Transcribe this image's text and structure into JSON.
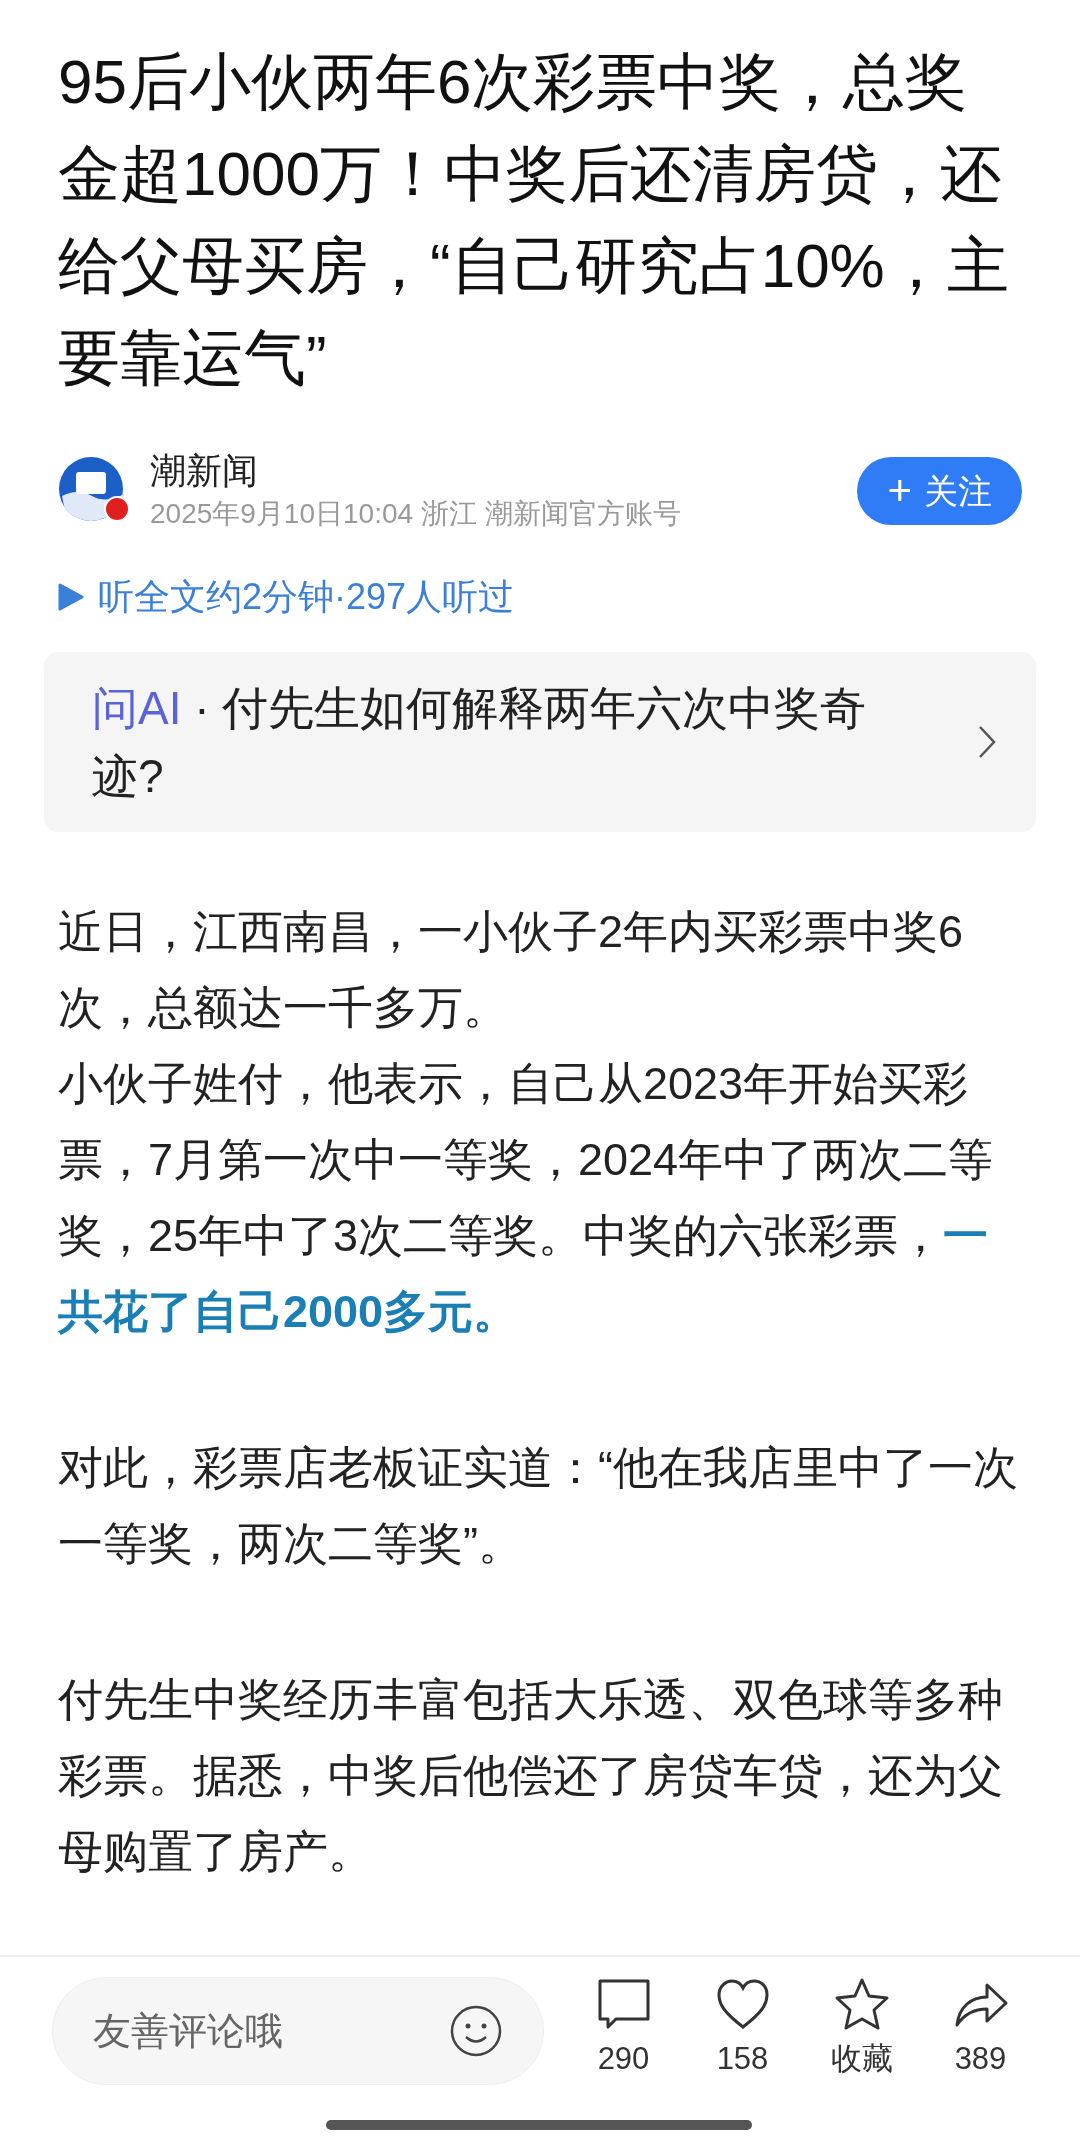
{
  "title": "95后小伙两年6次彩票中奖，总奖金超1000万！中奖后还清房贷，还给父母买房，“自己研究占10%，主要靠运气”",
  "author": {
    "name": "潮新闻",
    "meta": "2025年9月10日10:04 浙江 潮新闻官方账号",
    "verified": true,
    "follow_label": "关注",
    "follow_icon": "+"
  },
  "listen": {
    "label": "听全文约2分钟·297人听过"
  },
  "ask_ai": {
    "label": "问AI",
    "question": "· 付先生如何解释两年六次中奖奇迹?"
  },
  "sections": [
    {
      "paragraphs": [
        {
          "segments": [
            {
              "text": "近日，江西南昌，一小伙子2年内买彩票中奖6次，总额达一千多万。",
              "highlight": false
            }
          ]
        },
        {
          "segments": [
            {
              "text": "小伙子姓付，他表示，自己从2023年开始买彩票，7月第一次中一等奖，2024年中了两次二等奖，25年中了3次二等奖。中奖的六张彩票，",
              "highlight": false
            },
            {
              "text": "一共花了自己2000多元。",
              "highlight": true
            }
          ]
        }
      ]
    },
    {
      "paragraphs": [
        {
          "segments": [
            {
              "text": "对此，彩票店老板证实道：“他在我店里中了一次一等奖，两次二等奖”。",
              "highlight": false
            }
          ]
        }
      ]
    },
    {
      "paragraphs": [
        {
          "segments": [
            {
              "text": "付先生中奖经历丰富包括大乐透、双色球等多种彩票。据悉，中奖后他偿还了房贷车贷，还为父母购置了房产。",
              "highlight": false
            }
          ]
        }
      ]
    }
  ],
  "bottom_bar": {
    "comment_placeholder": "友善评论哦",
    "actions": [
      {
        "kind": "comment",
        "label": "290"
      },
      {
        "kind": "like",
        "label": "158"
      },
      {
        "kind": "favorite",
        "label": "收藏"
      },
      {
        "kind": "share",
        "label": "389"
      }
    ]
  }
}
